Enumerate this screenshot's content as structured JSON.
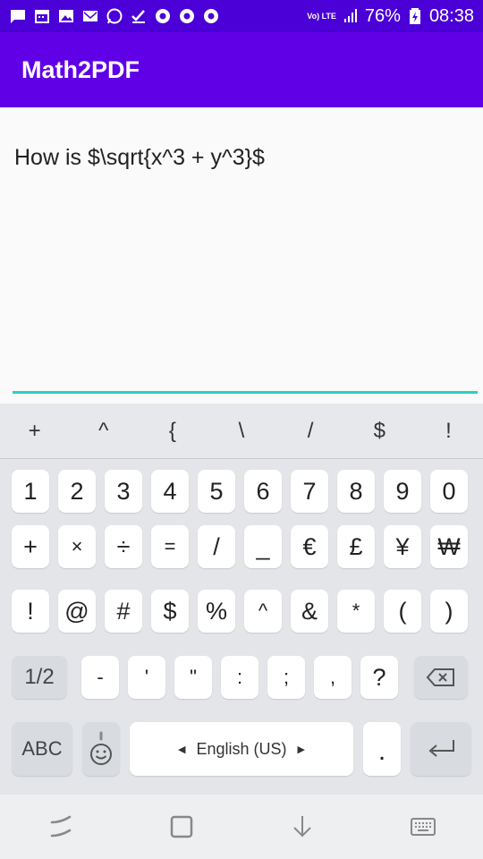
{
  "status_bar": {
    "battery_percent": "76%",
    "time": "08:38",
    "volte": "Vo) LTE",
    "notification_icons": [
      "message-icon",
      "calendar-icon",
      "photo-icon",
      "gmail-icon",
      "whatsapp-icon",
      "check-icon",
      "chrome-icon",
      "chrome-icon",
      "chrome-icon"
    ]
  },
  "app_bar": {
    "title": "Math2PDF"
  },
  "editor": {
    "text": "How is $\\sqrt{x^3 + y^3}$"
  },
  "keyboard": {
    "quick_row": [
      "+",
      "^",
      "{",
      "\\",
      "/",
      "$",
      "!"
    ],
    "row1": [
      "1",
      "2",
      "3",
      "4",
      "5",
      "6",
      "7",
      "8",
      "9",
      "0"
    ],
    "row2": [
      "+",
      "×",
      "÷",
      "=",
      "/",
      "_",
      "€",
      "£",
      "¥",
      "₩"
    ],
    "row3": [
      "!",
      "@",
      "#",
      "$",
      "%",
      "^",
      "&",
      "*",
      "(",
      ")"
    ],
    "row4": {
      "shift": "1/2",
      "keys": [
        "-",
        "'",
        "\"",
        ":",
        ";",
        ",",
        "?"
      ]
    },
    "row5": {
      "abc": "ABC",
      "space": "English (US)",
      "period": "."
    }
  },
  "colors": {
    "status_bar": "#4a00d6",
    "app_bar": "#5f00e6",
    "underline": "#2ad0c2"
  }
}
